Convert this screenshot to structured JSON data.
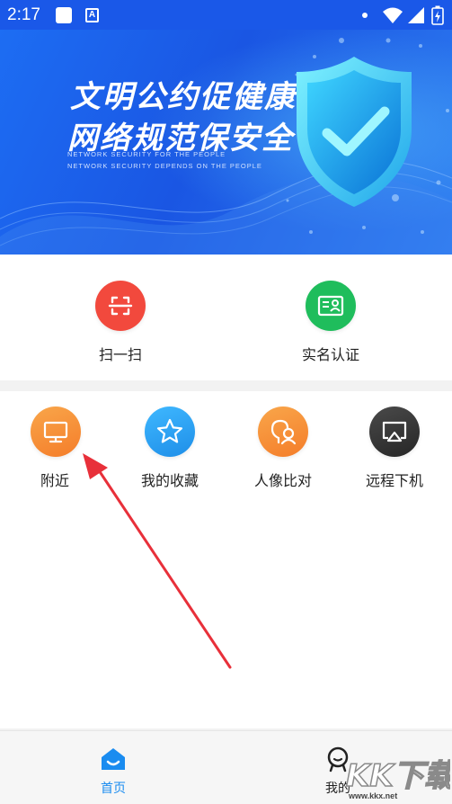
{
  "status_bar": {
    "time": "2:17",
    "keyboard_badge": "A"
  },
  "banner": {
    "headline_line1": "文明公约促健康",
    "headline_line2": "网络规范保安全",
    "subtitle_line1": "NETWORK SECURITY FOR THE PEOPLE",
    "subtitle_line2": "NETWORK SECURITY DEPENDS ON THE PEOPLE"
  },
  "quick_actions": [
    {
      "label": "扫一扫",
      "icon": "scan-icon",
      "color": "#f2493d"
    },
    {
      "label": "实名认证",
      "icon": "id-card-icon",
      "color": "#1fbd5c"
    }
  ],
  "features": [
    {
      "label": "附近",
      "icon": "monitor-icon",
      "color": "#f7923a"
    },
    {
      "label": "我的收藏",
      "icon": "star-icon",
      "color": "#2fa3f2"
    },
    {
      "label": "人像比对",
      "icon": "face-compare-icon",
      "color": "#f7923a"
    },
    {
      "label": "远程下机",
      "icon": "airplay-icon",
      "color": "#383838"
    }
  ],
  "bottom_nav": [
    {
      "label": "首页",
      "icon": "home-icon",
      "active": true,
      "color": "#1a8cf0"
    },
    {
      "label": "我的",
      "icon": "profile-icon",
      "active": false,
      "color": "#222222"
    }
  ],
  "watermark": {
    "text": "KK下载",
    "url": "www.kkx.net"
  }
}
